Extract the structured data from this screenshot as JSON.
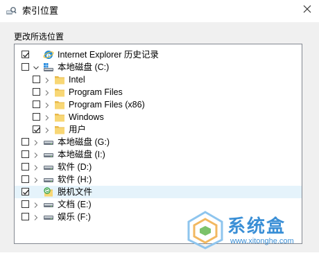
{
  "window": {
    "title": "索引位置",
    "icon": "index-options-icon",
    "close_icon": "close-icon"
  },
  "section_label": "更改所选位置",
  "tree": [
    {
      "label": "Internet Explorer 历史记录",
      "checked": true,
      "expander": "none",
      "icon": "internet-explorer-icon",
      "selected": false,
      "level": 0
    },
    {
      "label": "本地磁盘 (C:)",
      "checked": false,
      "expander": "expanded",
      "icon": "windows-drive-icon",
      "selected": false,
      "level": 0
    },
    {
      "label": "Intel",
      "checked": false,
      "expander": "collapsed",
      "icon": "folder-icon",
      "selected": false,
      "level": 1
    },
    {
      "label": "Program Files",
      "checked": false,
      "expander": "collapsed",
      "icon": "folder-icon",
      "selected": false,
      "level": 1
    },
    {
      "label": "Program Files (x86)",
      "checked": false,
      "expander": "collapsed",
      "icon": "folder-icon",
      "selected": false,
      "level": 1
    },
    {
      "label": "Windows",
      "checked": false,
      "expander": "collapsed",
      "icon": "folder-icon",
      "selected": false,
      "level": 1
    },
    {
      "label": "用户",
      "checked": true,
      "expander": "collapsed",
      "icon": "folder-icon",
      "selected": false,
      "level": 1
    },
    {
      "label": "本地磁盘 (G:)",
      "checked": false,
      "expander": "collapsed",
      "icon": "drive-icon",
      "selected": false,
      "level": 0
    },
    {
      "label": "本地磁盘 (I:)",
      "checked": false,
      "expander": "collapsed",
      "icon": "drive-icon",
      "selected": false,
      "level": 0
    },
    {
      "label": "软件 (D:)",
      "checked": false,
      "expander": "collapsed",
      "icon": "drive-icon",
      "selected": false,
      "level": 0
    },
    {
      "label": "软件 (H:)",
      "checked": false,
      "expander": "collapsed",
      "icon": "drive-icon",
      "selected": false,
      "level": 0
    },
    {
      "label": "脱机文件",
      "checked": true,
      "expander": "none",
      "icon": "offline-files-icon",
      "selected": true,
      "level": 0
    },
    {
      "label": "文档 (E:)",
      "checked": false,
      "expander": "collapsed",
      "icon": "drive-icon",
      "selected": false,
      "level": 0
    },
    {
      "label": "娱乐 (F:)",
      "checked": false,
      "expander": "collapsed",
      "icon": "drive-icon",
      "selected": false,
      "level": 0
    }
  ],
  "watermark": {
    "text": "系统盒",
    "url": "www.xitonghe.com",
    "icon": "xitonghe-logo-icon"
  },
  "colors": {
    "selection": "#e5f3fb",
    "folder": "#f8d775",
    "folder_dark": "#e8b84a",
    "accent": "#3a8fd6"
  }
}
